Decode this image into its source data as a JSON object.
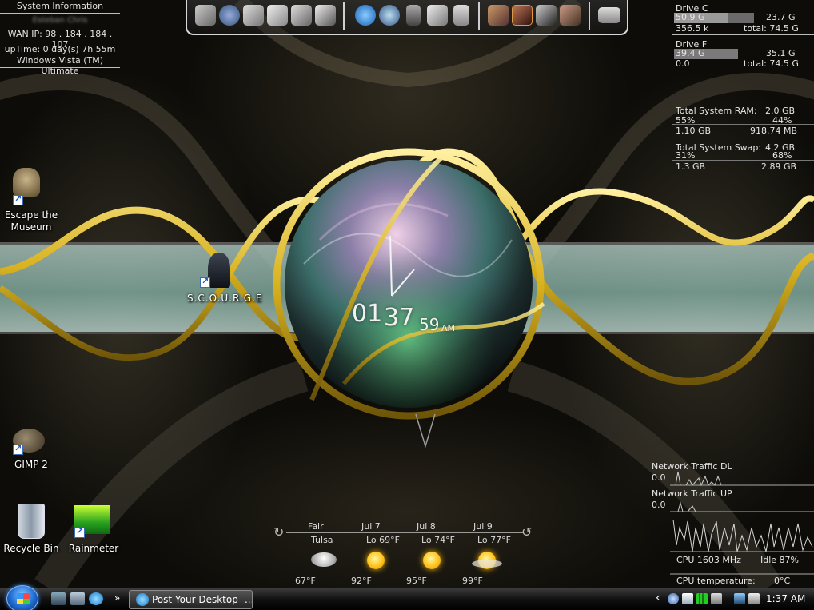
{
  "system_info": {
    "title": "System Information",
    "user": "Esteban Chris",
    "wan_ip": "WAN IP: 98 . 184 . 184 . 107",
    "uptime": "upTime: 0 day(s) 7h 55m",
    "os": "Windows Vista (TM) Ultimate"
  },
  "drives": [
    {
      "name": "Drive C",
      "used": "50.9 G",
      "free": "23.7 G",
      "rate": "356.5 k",
      "total": "total: 74.5 G",
      "used_fraction": 0.68
    },
    {
      "name": "Drive F",
      "used": "39.4 G",
      "free": "35.1 G",
      "rate": "0.0",
      "total": "total: 74.5 G",
      "used_fraction": 0.53
    }
  ],
  "ram": {
    "label": "Total System RAM:",
    "total": "2.0 GB",
    "pct_left": "55%",
    "pct_right": "44%",
    "used": "1.10 GB",
    "free": "918.74 MB"
  },
  "swap": {
    "label": "Total System Swap:",
    "total": "4.2 GB",
    "pct_left": "31%",
    "pct_right": "68%",
    "used": "1.3 GB",
    "free": "2.89 GB"
  },
  "desktop_icons": {
    "escape": "Escape the Museum",
    "scourge": "S.C.O.U.R.G.E",
    "gimp": "GIMP 2",
    "recycle": "Recycle Bin",
    "rainmeter": "Rainmeter"
  },
  "clock": {
    "hour": "01",
    "minute": "37",
    "second": "59",
    "ampm": "AM"
  },
  "weather": {
    "current": {
      "condition": "Fair",
      "city": "Tulsa",
      "temp": "67°F"
    },
    "forecast": [
      {
        "date": "Jul 7",
        "lo": "Lo 69°F",
        "hi": "92°F"
      },
      {
        "date": "Jul 8",
        "lo": "Lo 74°F",
        "hi": "95°F"
      },
      {
        "date": "Jul 9",
        "lo": "Lo 77°F",
        "hi": "99°F"
      }
    ]
  },
  "network": {
    "dl_label": "Network Traffic DL",
    "dl_value": "0.0",
    "up_label": "Network Traffic UP",
    "up_value": "0.0",
    "cpu": "CPU 1603 MHz",
    "idle": "Idle 87%",
    "temp_label": "CPU temperature:",
    "temp_value": "0°C"
  },
  "taskbar": {
    "task_title": "Post Your Desktop -...",
    "expand": "»",
    "tray_chevron": "‹",
    "time": "1:37 AM"
  },
  "colors": {
    "gold": "#d9b21f",
    "teal_band": "#8fb3a8",
    "taskbar": "#111111",
    "start_orb": "#1c6ad2"
  },
  "icons": [
    "computer-icon",
    "network-globe-icon",
    "folder-icon",
    "open-folder-icon",
    "document-folder-icon",
    "tools-icon",
    "internet-explorer-icon",
    "globe-icon",
    "lamp-icon",
    "horse-icon",
    "recycle-bin-icon",
    "game-character-icon",
    "diablo-icon",
    "ram-head-icon",
    "warrior-icon",
    "calendar-icon"
  ]
}
